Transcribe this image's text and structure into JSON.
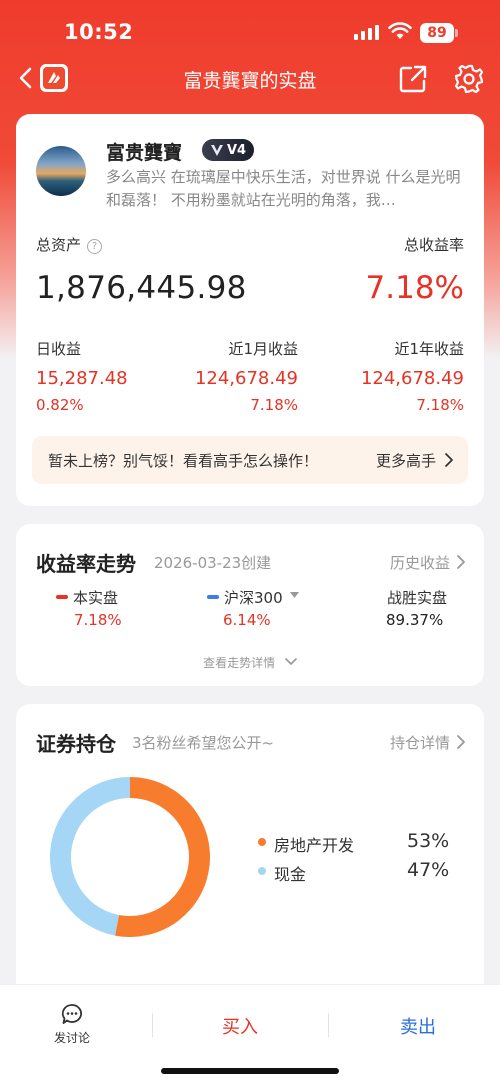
{
  "status_bar": {
    "time": "10:52",
    "battery": "89"
  },
  "nav": {
    "title": "富贵龔寶的实盘"
  },
  "profile": {
    "name": "富贵龔寶",
    "level_badge": "V4",
    "bio": "多么高兴 在琉璃屋中快乐生活，对世界说 什么是光明和磊落！ 不用粉墨就站在光明的角落，我…"
  },
  "summary": {
    "total_assets_label": "总资产",
    "total_assets": "1,876,445.98",
    "total_rate_label": "总收益率",
    "total_rate": "7.18%",
    "stats": [
      {
        "label": "日收益",
        "value": "15,287.48",
        "pct": "0.82%"
      },
      {
        "label": "近1月收益",
        "value": "124,678.49",
        "pct": "7.18%"
      },
      {
        "label": "近1年收益",
        "value": "124,678.49",
        "pct": "7.18%"
      }
    ],
    "rank_text": "暂未上榜？别气馁！看看高手怎么操作！",
    "rank_more": "更多高手"
  },
  "trend": {
    "title": "收益率走势",
    "created": "2026-03-23创建",
    "history_link": "历史收益",
    "legend": [
      {
        "name": "本实盘",
        "value": "7.18%",
        "color": "#e63325"
      },
      {
        "name": "沪深300",
        "value": "6.14%",
        "color": "#3b7ee6"
      },
      {
        "name": "战胜实盘",
        "value": "89.37%",
        "color": "#222222"
      }
    ],
    "detail_link": "查看走势详情"
  },
  "holdings": {
    "title": "证券持仓",
    "subtitle": "3名粉丝希望您公开~",
    "detail_link": "持仓详情",
    "items": [
      {
        "name": "房地产开发",
        "pct": "53%",
        "value": 53,
        "color": "#f77c2e"
      },
      {
        "name": "现金",
        "pct": "47%",
        "value": 47,
        "color": "#a6d6f5"
      }
    ]
  },
  "bottom_bar": {
    "discuss": "发讨论",
    "buy": "买入",
    "sell": "卖出"
  }
}
